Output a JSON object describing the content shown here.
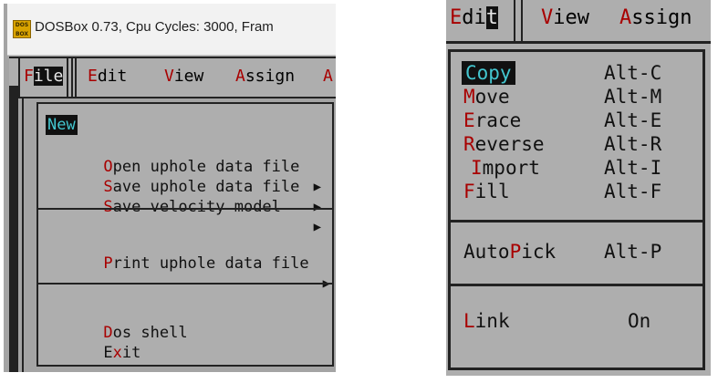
{
  "left": {
    "window_title": "DOSBox 0.73, Cpu Cycles:     3000, Fram",
    "icon_text": "DOS BOX",
    "menubar": [
      {
        "hot": "F",
        "rest_before": "",
        "rest": "ile"
      },
      {
        "hot": "E",
        "rest": "dit"
      },
      {
        "hot": "V",
        "rest": "iew"
      },
      {
        "hot": "A",
        "rest": "ssign"
      },
      {
        "hot": "A",
        "rest": ""
      }
    ],
    "file_menu": {
      "new": "New",
      "open": {
        "hot": "O",
        "rest": "pen uphole data file"
      },
      "save_uphole": {
        "hot": "S",
        "rest": "ave uphole data file"
      },
      "save_velocity": {
        "hot": "S",
        "rest": "ave velocity model"
      },
      "print": {
        "hot": "P",
        "rest": "rint uphole data file"
      },
      "dos": {
        "hot": "D",
        "rest": "os shell"
      },
      "exit": {
        "pre": "E",
        "hot": "x",
        "rest": "it"
      },
      "arrow": "▶"
    }
  },
  "right": {
    "menubar": {
      "edit": {
        "hot": "E",
        "mid": "di",
        "sel": "t"
      },
      "view": {
        "hot": "V",
        "rest": "iew"
      },
      "assign": {
        "hot": "A",
        "rest": "ssign"
      }
    },
    "edit_menu": [
      {
        "label": "Copy",
        "shortcut": "Alt-C"
      },
      {
        "hot": "M",
        "rest": "ove",
        "shortcut": "Alt-M"
      },
      {
        "hot": "E",
        "rest": "race",
        "shortcut": "Alt-E"
      },
      {
        "hot": "R",
        "rest": "everse",
        "shortcut": "Alt-R"
      },
      {
        "hot": "I",
        "rest": "mport",
        "shortcut": "Alt-I"
      },
      {
        "hot": "F",
        "rest": "ill",
        "shortcut": "Alt-F"
      },
      {
        "pre": "Auto",
        "hot": "P",
        "rest": "ick",
        "shortcut": "Alt-P"
      },
      {
        "hot": "L",
        "rest": "ink",
        "shortcut": "On"
      }
    ]
  },
  "colors": {
    "menu_bg": "#aeaeae",
    "hotkey": "#a80000",
    "highlight_text": "#43c6cf",
    "highlight_bg": "#111111"
  }
}
